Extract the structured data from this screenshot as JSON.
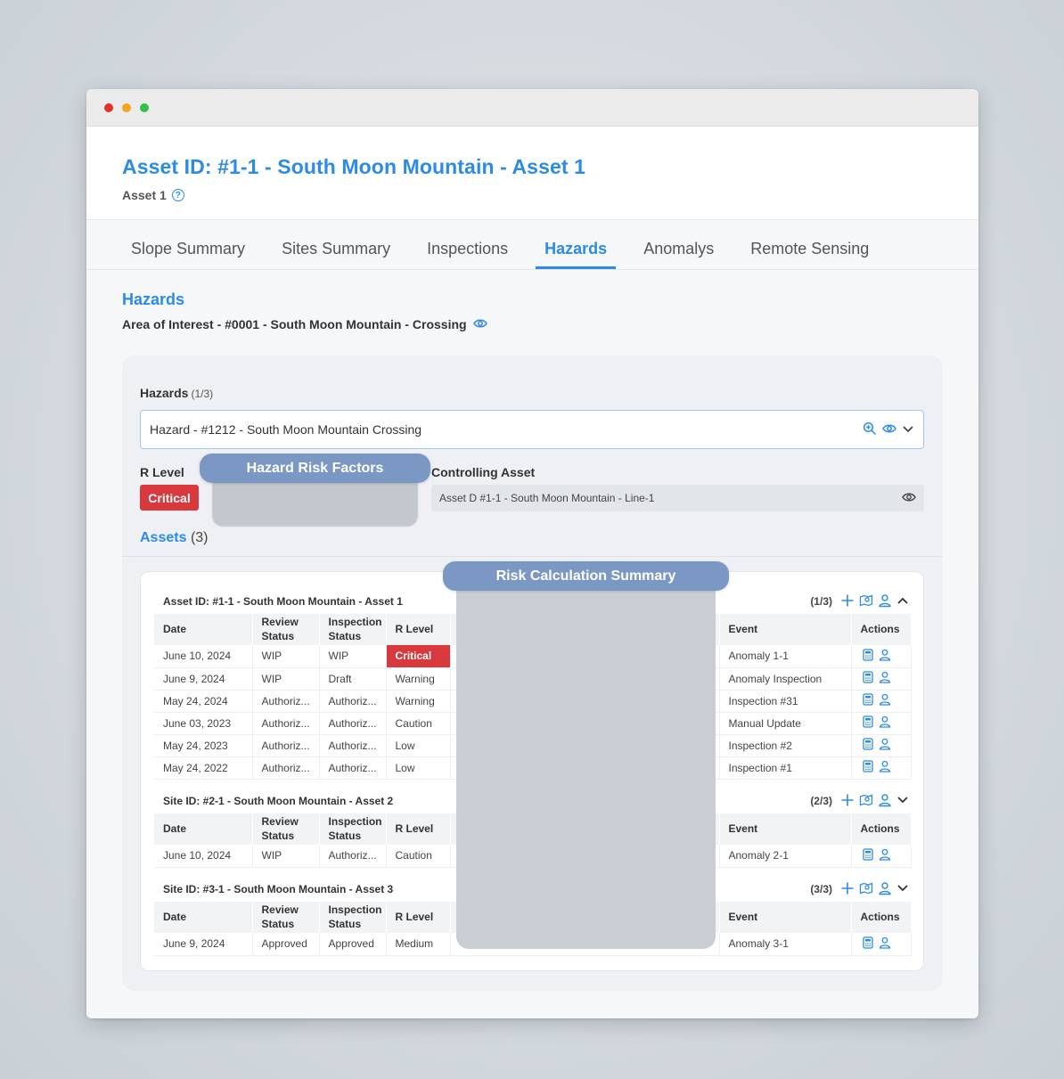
{
  "header": {
    "title": "Asset ID: #1-1 - South Moon Mountain - Asset 1",
    "subtitle": "Asset 1",
    "help_icon": "question-circle-icon"
  },
  "tabs": [
    {
      "label": "Slope Summary",
      "active": false
    },
    {
      "label": "Sites Summary",
      "active": false
    },
    {
      "label": "Inspections",
      "active": false
    },
    {
      "label": "Hazards",
      "active": true
    },
    {
      "label": "Anomalys",
      "active": false
    },
    {
      "label": "Remote Sensing",
      "active": false
    }
  ],
  "section": {
    "title": "Hazards",
    "area_of_interest": "Area of Interest - #0001 - South Moon Mountain - Crossing"
  },
  "hazard_panel": {
    "label": "Hazards",
    "count": "(1/3)",
    "selected": "Hazard - #1212 - South Moon Mountain Crossing",
    "r_level_label": "R Level",
    "r_level_value": "Critical",
    "risk_factors_label": "Hazard Risk Factors",
    "controlling_asset_label": "Controlling Asset",
    "controlling_asset_value": "Asset D #1-1 - South Moon Mountain - Line-1",
    "assets_label": "Assets",
    "assets_count": "(3)",
    "risk_summary_label": "Risk Calculation Summary"
  },
  "columns": {
    "date": "Date",
    "review": "Review Status",
    "inspection": "Inspection Status",
    "rlevel": "R Level",
    "event": "Event",
    "actions": "Actions"
  },
  "groups": [
    {
      "title": "Asset ID: #1-1 - South Moon Mountain - Asset 1",
      "fraction": "(1/3)",
      "expanded": true,
      "rows": [
        {
          "date": "June 10, 2024",
          "review": "WIP",
          "inspection": "WIP",
          "rlevel": "Critical",
          "event": "Anomaly 1-1"
        },
        {
          "date": "June 9, 2024",
          "review": "WIP",
          "inspection": "Draft",
          "rlevel": "Warning",
          "event": "Anomaly Inspection"
        },
        {
          "date": "May 24, 2024",
          "review": "Authoriz...",
          "inspection": "Authoriz...",
          "rlevel": "Warning",
          "event": "Inspection #31"
        },
        {
          "date": "June 03, 2023",
          "review": "Authoriz...",
          "inspection": "Authoriz...",
          "rlevel": "Caution",
          "event": "Manual Update"
        },
        {
          "date": "May 24, 2023",
          "review": "Authoriz...",
          "inspection": "Authoriz...",
          "rlevel": "Low",
          "event": "Inspection #2"
        },
        {
          "date": "May 24, 2022",
          "review": "Authoriz...",
          "inspection": "Authoriz...",
          "rlevel": "Low",
          "event": "Inspection #1"
        }
      ]
    },
    {
      "title": "Site ID: #2-1 - South Moon Mountain - Asset 2",
      "fraction": "(2/3)",
      "expanded": false,
      "rows": [
        {
          "date": "June 10, 2024",
          "review": "WIP",
          "inspection": "Authoriz...",
          "rlevel": "Caution",
          "event": "Anomaly 2-1"
        }
      ]
    },
    {
      "title": "Site ID: #3-1 - South Moon Mountain - Asset 3",
      "fraction": "(3/3)",
      "expanded": false,
      "rows": [
        {
          "date": "June 9, 2024",
          "review": "Approved",
          "inspection": "Approved",
          "rlevel": "Medium",
          "event": "Anomaly 3-1"
        }
      ]
    }
  ],
  "colors": {
    "accent": "#2b8be6",
    "critical": "#d9393c",
    "overlay_pill": "#7a98c3"
  }
}
